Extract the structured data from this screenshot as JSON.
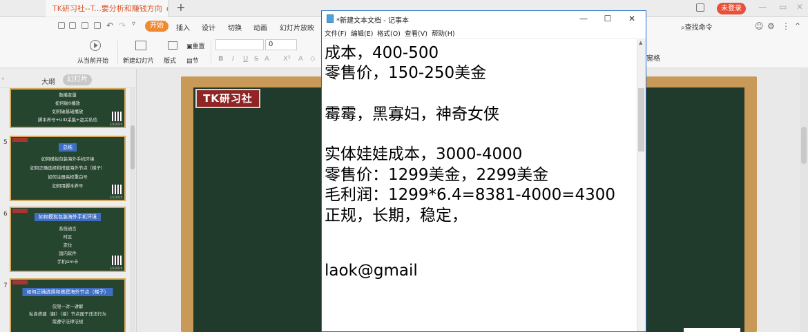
{
  "colors": {
    "accent": "#f08a30",
    "login": "#e8503a",
    "board_frame": "#c99a57",
    "board": "#203b2b",
    "notepad_border": "#1a6cc8"
  },
  "wps": {
    "doc_tab": "TK研习社--T...要分析和赚钱方向",
    "new_tab": "+",
    "login_label": "未登录",
    "menu": {
      "start": "开始",
      "insert": "插入",
      "design": "设计",
      "switch": "切换",
      "animation": "动画",
      "slideshow": "幻灯片放映"
    },
    "search_cmd": "查找命令",
    "ribbon": {
      "from_current": "从当前开始",
      "new_slide": "新建幻灯片",
      "layout": "版式",
      "section": "节",
      "reset": "重置",
      "font_size": "0",
      "right_cut": "窗格"
    },
    "pane": {
      "outline": "大纲",
      "slides": "幻灯片"
    },
    "slides": [
      {
        "num": "",
        "heading": "",
        "lines": [
          "散播变量",
          "如何破0播放",
          "如何破基础播放",
          "脚本养号+UID采集+超关私信"
        ],
        "date": "3/1/2019"
      },
      {
        "num": "5",
        "heading": "总结",
        "lines": [
          "如何模拟包装海外手机环境",
          "如何正确选择和搭建海外节点（梯子）",
          "如何注册高权重白号",
          "如何用脚本养号"
        ],
        "date": "3/1/2019"
      },
      {
        "num": "6",
        "heading": "如何模拟包装海外手机环境",
        "lines": [
          "系统语言",
          "时区",
          "定位",
          "国内软件",
          "手机sim卡"
        ],
        "date": "3/1/2019"
      },
      {
        "num": "7",
        "heading": "如何正确选择和搭建海外节点（梯子）",
        "lines": [
          "仅限一对一讲解",
          "私自搭建（翻）（墙）节点属于违法行为",
          "需遵守法律法规"
        ],
        "date": ""
      }
    ],
    "logo": "TK研习社"
  },
  "notepad": {
    "title": "*新建文本文档 - 记事本",
    "menu": [
      "文件(F)",
      "编辑(E)",
      "格式(O)",
      "查看(V)",
      "帮助(H)"
    ],
    "lines": [
      "成本，400-500",
      "零售价，150-250美金",
      "霉霉，黑寡妇，神奇女侠",
      "实体娃娃成本，3000-4000",
      "零售价：1299美金，2299美金",
      "毛利润：1299*6.4=8381-4000=4300",
      "正规，长期，稳定，",
      "laok@gmail"
    ]
  }
}
